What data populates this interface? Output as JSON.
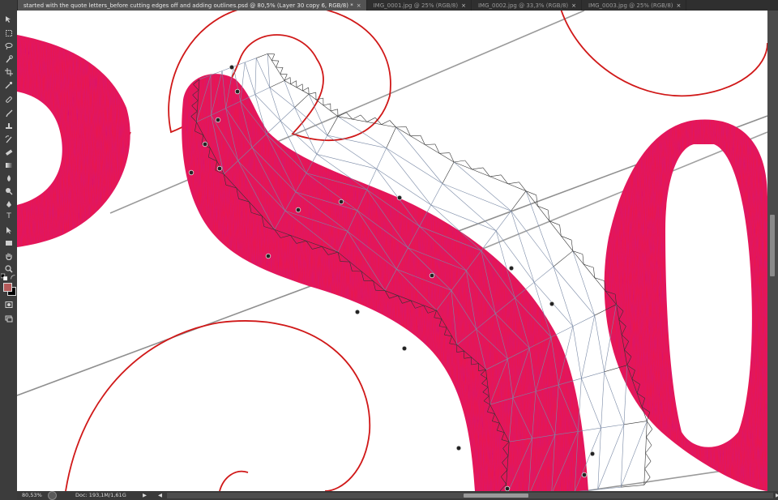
{
  "tabs": [
    {
      "label": "started with the quote letters_before cutting edges off and adding outlines.psd @ 80,5% (Layer 30 copy 6, RGB/8) *",
      "active": true
    },
    {
      "label": "IMG_0001.jpg @ 25% (RGB/8)",
      "active": false
    },
    {
      "label": "IMG_0002.jpg @ 33,3% (RGB/8)",
      "active": false
    },
    {
      "label": "IMG_0003.jpg @ 25% (RGB/8)",
      "active": false
    }
  ],
  "close_glyph": "×",
  "tools": [
    "move-tool-icon",
    "marquee-tool-icon",
    "lasso-tool-icon",
    "quick-selection-tool-icon",
    "crop-tool-icon",
    "eyedropper-tool-icon",
    "spot-healing-tool-icon",
    "brush-tool-icon",
    "clone-stamp-tool-icon",
    "history-brush-tool-icon",
    "eraser-tool-icon",
    "gradient-tool-icon",
    "blur-tool-icon",
    "dodge-tool-icon",
    "pen-tool-icon",
    "type-tool-icon",
    "path-selection-tool-icon",
    "rectangle-tool-icon",
    "hand-tool-icon",
    "zoom-tool-icon"
  ],
  "type_tool_glyph": "T",
  "colors": {
    "foreground": "#b55a5a",
    "background": "#000000",
    "paint": "#e8194f",
    "outline": "#d01818",
    "mesh": "#333333"
  },
  "status": {
    "zoom": "80,53%",
    "doc": "Doc: 193,1M/1,61G",
    "arrow": "▶",
    "scroll_left": "◀",
    "scroll_right": "▶"
  }
}
